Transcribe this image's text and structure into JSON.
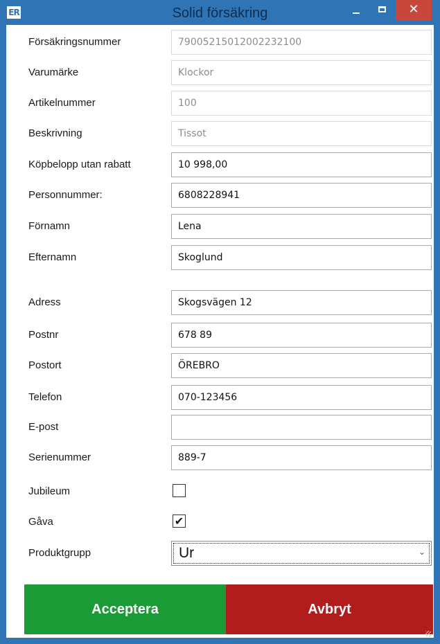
{
  "window": {
    "app_icon": "ER",
    "title": "Solid försäkring",
    "close_glyph": "✕"
  },
  "form": {
    "fields": [
      {
        "label": "Försäkringsnummer",
        "value": "79005215012002232100",
        "readonly": true
      },
      {
        "label": "Varumärke",
        "value": "Klockor",
        "readonly": true
      },
      {
        "label": "Artikelnummer",
        "value": "100",
        "readonly": true
      },
      {
        "label": "Beskrivning",
        "value": "Tissot",
        "readonly": true
      },
      {
        "label": "Köpbelopp utan rabatt",
        "value": "10 998,00",
        "readonly": false
      },
      {
        "label": "Personnummer:",
        "value": "6808228941",
        "readonly": false
      },
      {
        "label": "Förnamn",
        "value": "Lena",
        "readonly": false
      },
      {
        "label": "Efternamn",
        "value": "Skoglund",
        "readonly": false
      },
      {
        "label": "Adress",
        "value": "Skogsvägen 12",
        "readonly": false
      },
      {
        "label": "Postnr",
        "value": "678 89",
        "readonly": false
      },
      {
        "label": "Postort",
        "value": "ÖREBRO",
        "readonly": false
      },
      {
        "label": "Telefon",
        "value": "070-123456",
        "readonly": false
      },
      {
        "label": "E-post",
        "value": "",
        "readonly": false
      },
      {
        "label": "Serienummer",
        "value": "889-7",
        "readonly": false
      }
    ],
    "jubileum": {
      "label": "Jubileum",
      "checked": false
    },
    "gava": {
      "label": "Gåva",
      "checked": true,
      "check_glyph": "✔"
    },
    "produktgrupp": {
      "label": "Produktgrupp",
      "value": "Ur",
      "chevron": "⌄"
    }
  },
  "buttons": {
    "accept": "Acceptera",
    "cancel": "Avbryt"
  },
  "colors": {
    "frame": "#2f74b5",
    "accept": "#1b9b36",
    "cancel": "#b11c1c",
    "close": "#c9463d"
  }
}
